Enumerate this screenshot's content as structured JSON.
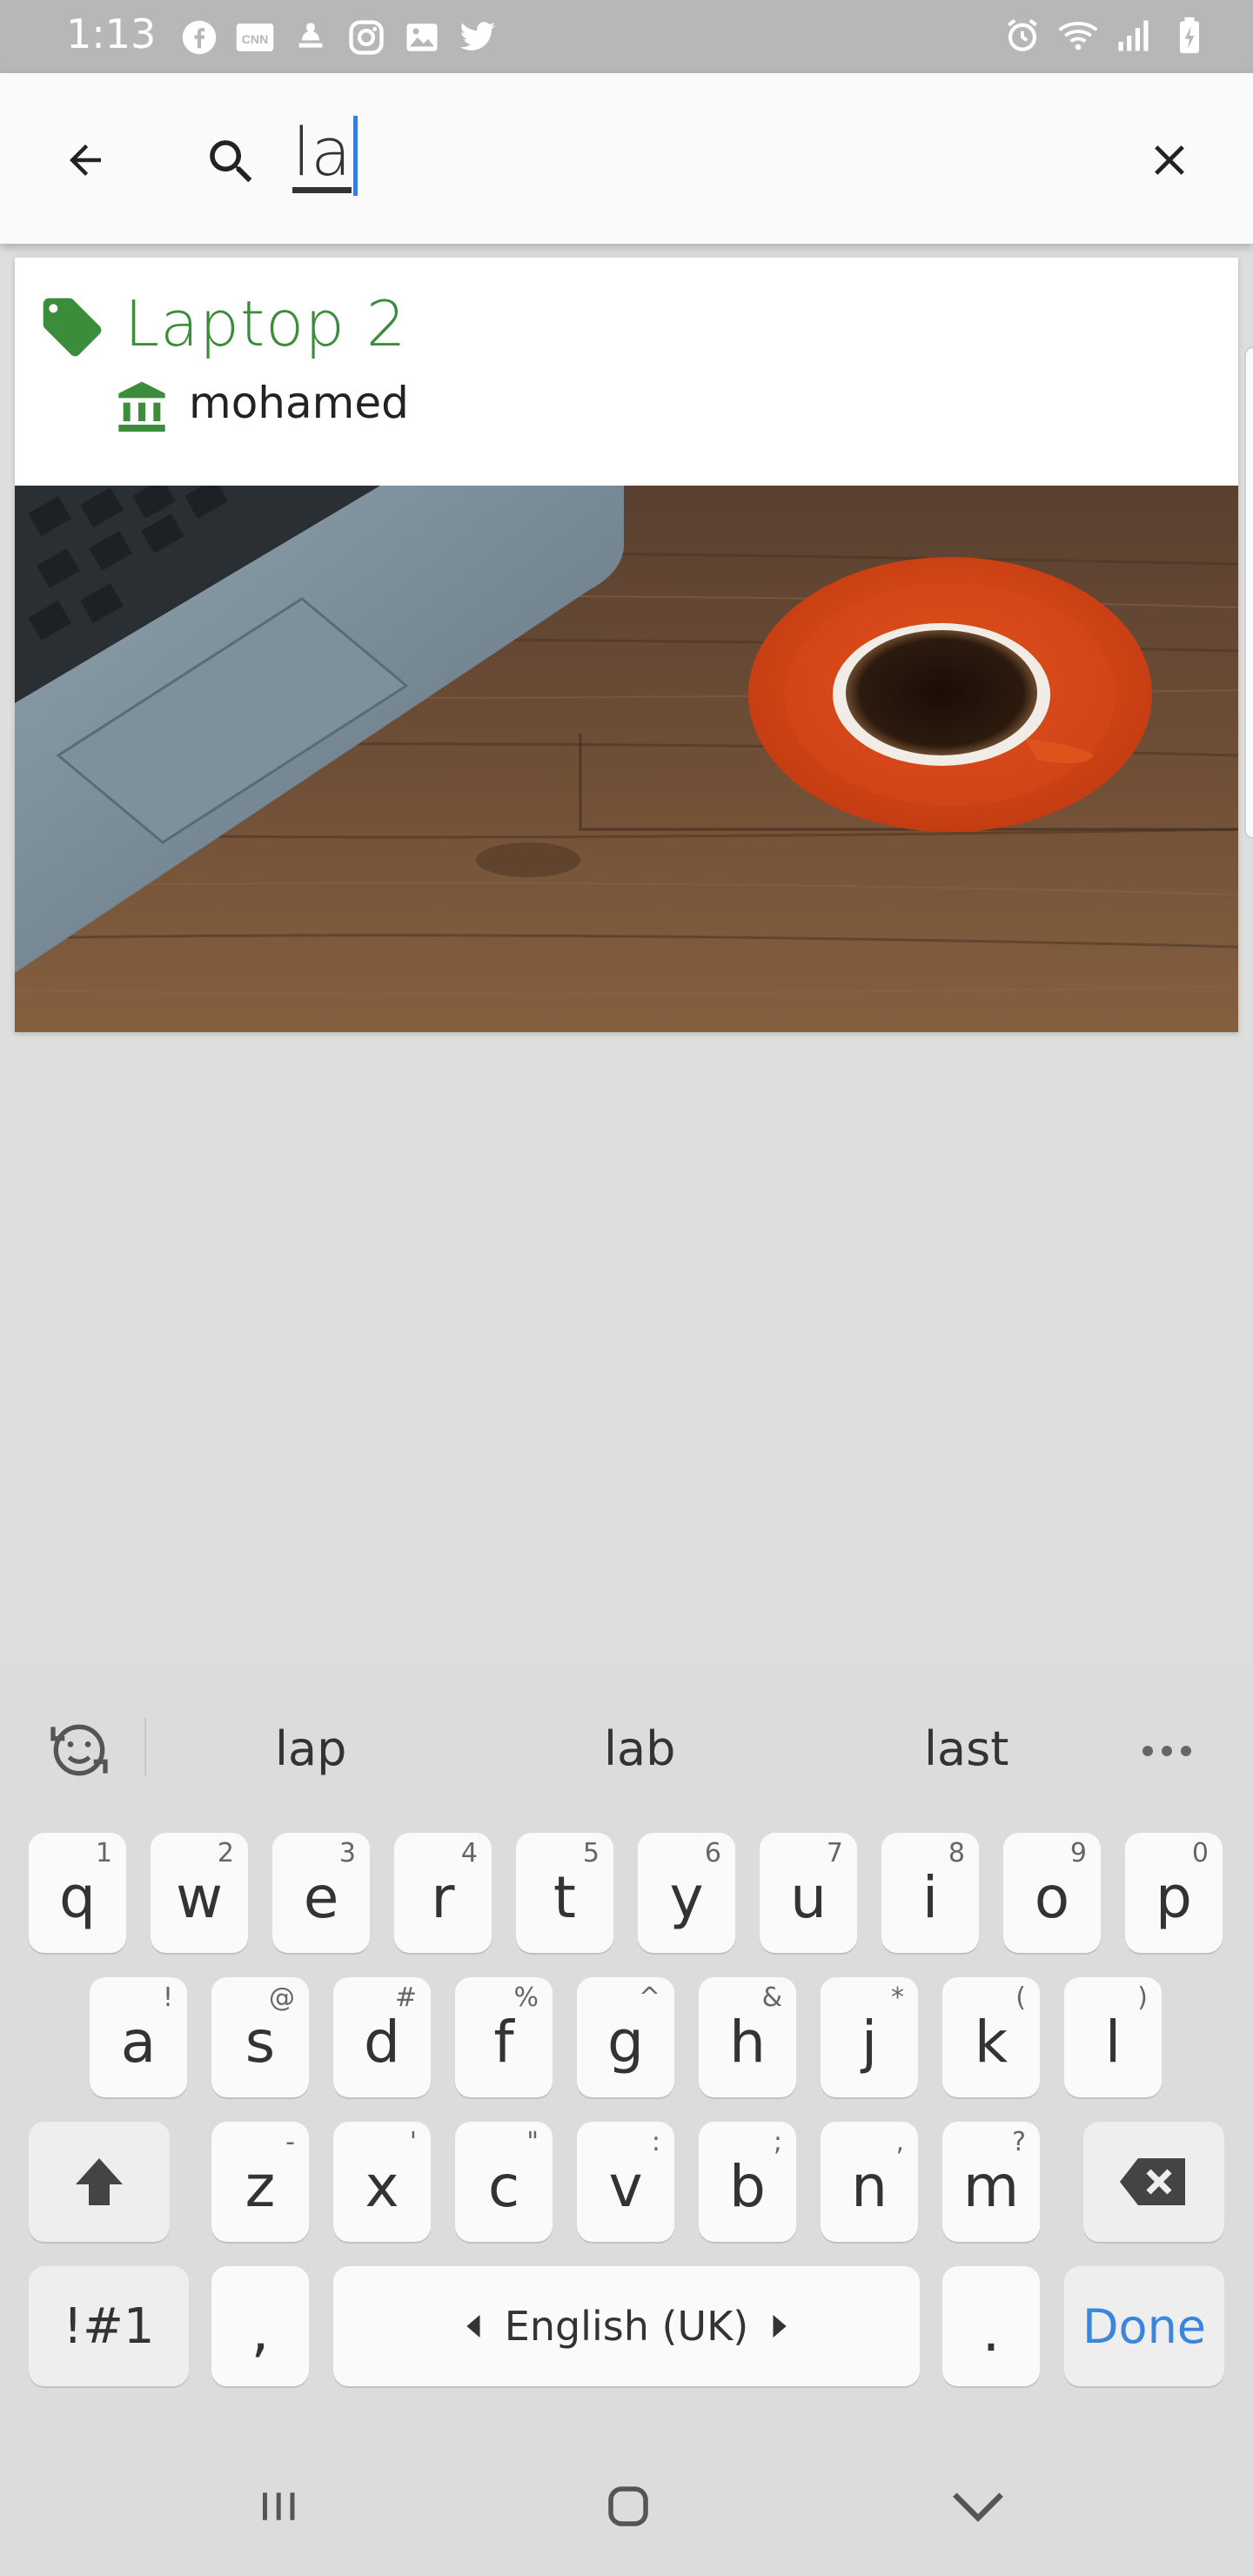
{
  "status_bar": {
    "time": "1:13",
    "left_icons": [
      "facebook-icon",
      "cnn-icon",
      "notification-icon",
      "instagram-icon",
      "gallery-icon",
      "twitter-icon"
    ],
    "right_icons": [
      "alarm-icon",
      "wifi-icon",
      "signal-icon",
      "battery-charging-icon"
    ]
  },
  "search": {
    "query": "la"
  },
  "result": {
    "title": "Laptop 2",
    "owner": "mohamed"
  },
  "keyboard": {
    "suggestions": [
      "lap",
      "lab",
      "last"
    ],
    "row1": [
      {
        "key": "q",
        "alt": "1"
      },
      {
        "key": "w",
        "alt": "2"
      },
      {
        "key": "e",
        "alt": "3"
      },
      {
        "key": "r",
        "alt": "4"
      },
      {
        "key": "t",
        "alt": "5"
      },
      {
        "key": "y",
        "alt": "6"
      },
      {
        "key": "u",
        "alt": "7"
      },
      {
        "key": "i",
        "alt": "8"
      },
      {
        "key": "o",
        "alt": "9"
      },
      {
        "key": "p",
        "alt": "0"
      }
    ],
    "row2": [
      {
        "key": "a",
        "alt": "!"
      },
      {
        "key": "s",
        "alt": "@"
      },
      {
        "key": "d",
        "alt": "#"
      },
      {
        "key": "f",
        "alt": "%"
      },
      {
        "key": "g",
        "alt": "^"
      },
      {
        "key": "h",
        "alt": "&"
      },
      {
        "key": "j",
        "alt": "*"
      },
      {
        "key": "k",
        "alt": "("
      },
      {
        "key": "l",
        "alt": ")"
      }
    ],
    "row3": [
      {
        "key": "z",
        "alt": "-"
      },
      {
        "key": "x",
        "alt": "'"
      },
      {
        "key": "c",
        "alt": "\""
      },
      {
        "key": "v",
        "alt": ":"
      },
      {
        "key": "b",
        "alt": ";"
      },
      {
        "key": "n",
        "alt": ","
      },
      {
        "key": "m",
        "alt": "?"
      }
    ],
    "symbols_label": "!#1",
    "comma_label": ",",
    "space_label": "English (UK)",
    "period_label": ".",
    "done_label": "Done"
  },
  "colors": {
    "accent_green": "#3b8c3b",
    "done_blue": "#3b86dc",
    "caret_blue": "#3b7ddd"
  }
}
